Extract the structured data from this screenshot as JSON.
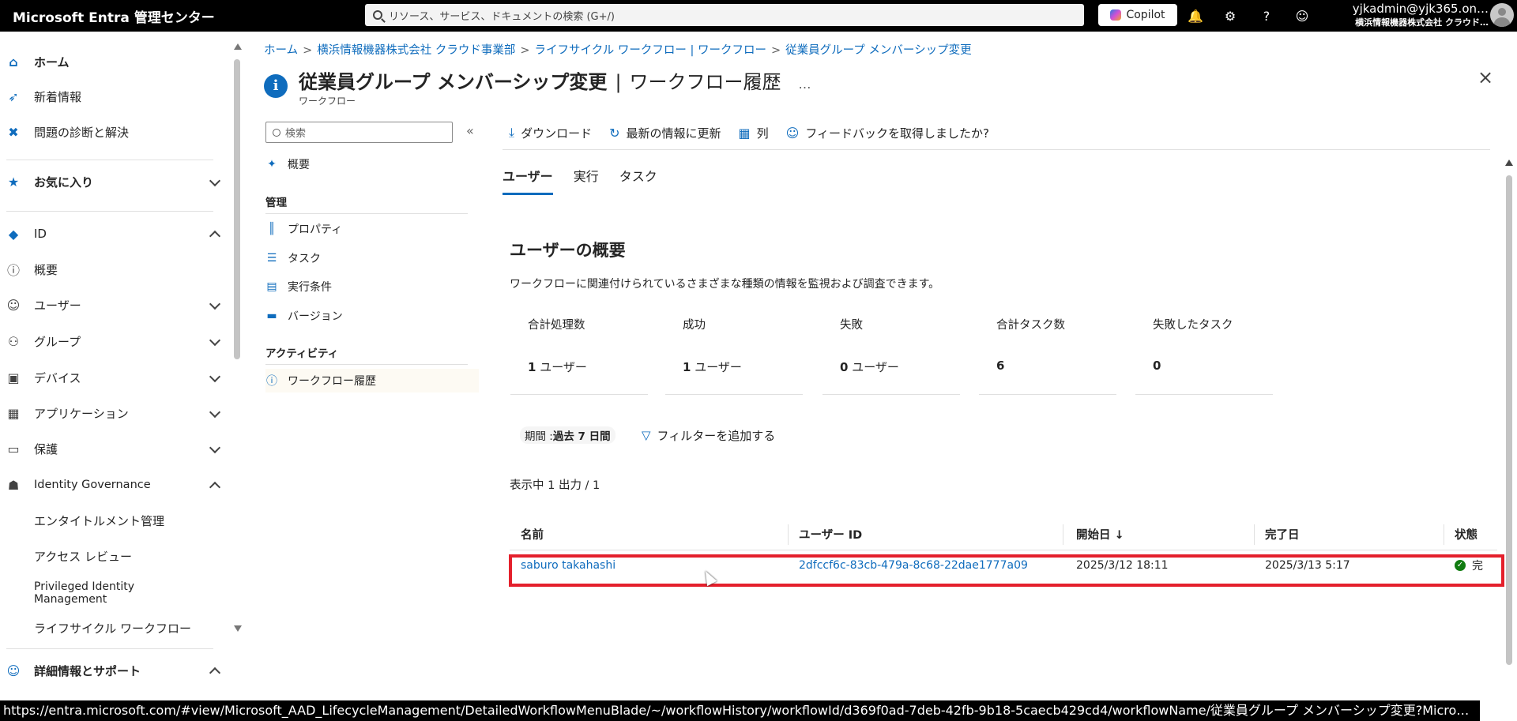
{
  "app": {
    "brand": "Microsoft Entra 管理センター",
    "search_placeholder": "リソース、サービス、ドキュメントの検索 (G+/)",
    "copilot_label": "Copilot",
    "account_email": "yjkadmin@yjk365.on…",
    "account_org": "横浜情報機器株式会社 クラウド…"
  },
  "leftnav": {
    "home": "ホーム",
    "whats_new": "新着情報",
    "diagnose": "問題の診断と解決",
    "favorites": "お気に入り",
    "id": "ID",
    "overview": "概要",
    "users": "ユーザー",
    "groups": "グループ",
    "devices": "デバイス",
    "applications": "アプリケーション",
    "protection": "保護",
    "identity_governance": "Identity Governance",
    "entitlement": "エンタイトルメント管理",
    "access_review": "アクセス レビュー",
    "pim_line1": "Privileged Identity",
    "pim_line2": "Management",
    "lifecycle": "ライフサイクル ワークフロー",
    "learn_support": "詳細情報とサポート"
  },
  "breadcrumb": [
    "ホーム",
    "横浜情報機器株式会社 クラウド事業部",
    "ライフサイクル ワークフロー | ワークフロー",
    "従業員グループ メンバーシップ変更"
  ],
  "page": {
    "title_main": "従業員グループ メンバーシップ変更",
    "title_sub": "ワークフロー履歴",
    "subtitle": "ワークフロー",
    "more": "…"
  },
  "submenu": {
    "search_placeholder": "検索",
    "overview": "概要",
    "manage_header": "管理",
    "properties": "プロパティ",
    "tasks": "タスク",
    "execution_conditions": "実行条件",
    "versions": "バージョン",
    "activity_header": "アクティビティ",
    "workflow_history": "ワークフロー履歴"
  },
  "toolbar": {
    "download": "ダウンロード",
    "refresh": "最新の情報に更新",
    "columns": "列",
    "feedback": "フィードバックを取得しましたか?"
  },
  "tabs": [
    "ユーザー",
    "実行",
    "タスク"
  ],
  "overview": {
    "title": "ユーザーの概要",
    "description": "ワークフローに関連付けられているさまざまな種類の情報を監視および調査できます。",
    "stats": [
      {
        "label": "合計処理数",
        "value": "1",
        "unit": "ユーザー"
      },
      {
        "label": "成功",
        "value": "1",
        "unit": "ユーザー"
      },
      {
        "label": "失敗",
        "value": "0",
        "unit": "ユーザー"
      },
      {
        "label": "合計タスク数",
        "value": "6",
        "unit": ""
      },
      {
        "label": "失敗したタスク",
        "value": "0",
        "unit": ""
      }
    ]
  },
  "filters": {
    "period_label": "期間 : ",
    "period_value": "過去 7 日間",
    "add_filter": "フィルターを追加する",
    "result_count": "表示中 1 出力 / 1"
  },
  "table": {
    "columns": [
      "名前",
      "ユーザー ID",
      "開始日 ↓",
      "完了日",
      "状態"
    ],
    "rows": [
      [
        "saburo takahashi",
        "2dfccf6c-83cb-479a-8c68-22dae1777a09",
        "2025/3/12 18:11",
        "2025/3/13 5:17",
        "完"
      ]
    ]
  },
  "statusbar": {
    "url": "https://entra.microsoft.com/#view/Microsoft_AAD_LifecycleManagement/DetailedWorkflowMenuBlade/~/workflowHistory/workflowId/d369f0ad-7deb-42fb-9b18-5caecb429cd4/workflowName/従業員グループ メンバーシップ変更?Micro…"
  },
  "colors": {
    "accent": "#0f6cbd",
    "highlight": "#e4202c",
    "success": "#107c10",
    "topbar": "#000000"
  }
}
